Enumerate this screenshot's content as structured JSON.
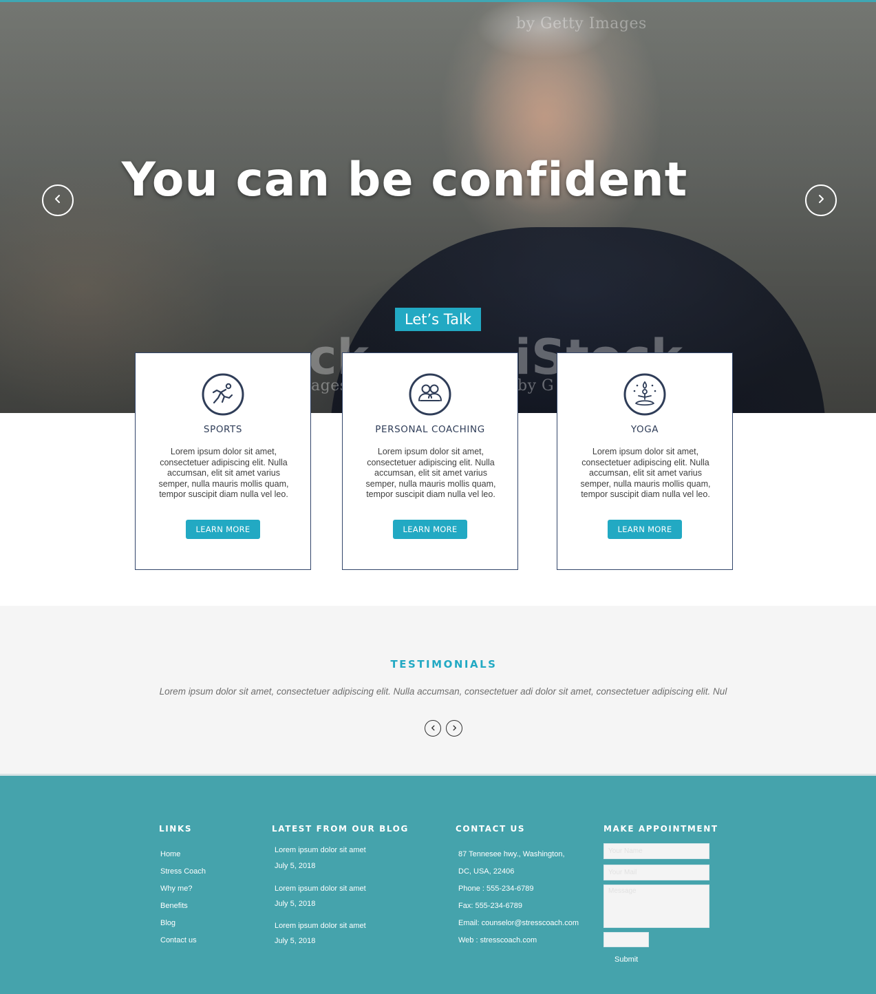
{
  "hero": {
    "title": "You can be confident",
    "cta_label": "Let’s Talk",
    "watermark_line": "by Getty Images",
    "watermark_big_left": "ck",
    "watermark_big_right": "iStock",
    "watermark_small_left": "ages",
    "watermark_small_right": "by G",
    "prev_icon": "chevron-left-icon",
    "next_icon": "chevron-right-icon"
  },
  "services": [
    {
      "title": "SPORTS",
      "icon": "runner-icon",
      "text": "Lorem ipsum dolor sit amet, consectetuer adipiscing elit. Nulla accumsan, elit sit amet varius semper, nulla mauris mollis quam, tempor suscipit diam nulla vel leo.",
      "button": "LEARN MORE"
    },
    {
      "title": "PERSONAL COACHING",
      "icon": "people-icon",
      "text": "Lorem ipsum dolor sit amet, consectetuer adipiscing elit. Nulla accumsan, elit sit amet varius semper, nulla mauris mollis quam, tempor suscipit diam nulla vel leo.",
      "button": "LEARN MORE"
    },
    {
      "title": "YOGA",
      "icon": "meditation-icon",
      "text": "Lorem ipsum dolor sit amet, consectetuer adipiscing elit. Nulla accumsan, elit sit amet varius semper, nulla mauris mollis quam, tempor suscipit diam nulla vel leo.",
      "button": "LEARN MORE"
    }
  ],
  "testimonials": {
    "title": "TESTIMONIALS",
    "text": "Lorem ipsum dolor sit amet, consectetuer adipiscing elit. Nulla accumsan, consectetuer adi dolor sit amet, consectetuer adipiscing elit. Nul"
  },
  "footer": {
    "links_heading": "LINKS",
    "links": [
      "Home",
      "Stress Coach",
      "Why me?",
      "Benefits",
      "Blog",
      "Contact us"
    ],
    "blog_heading": "LATEST FROM OUR BLOG",
    "blog_posts": [
      {
        "title": "Lorem ipsum dolor sit amet",
        "date": "July 5, 2018"
      },
      {
        "title": "Lorem ipsum dolor sit amet",
        "date": "July 5, 2018"
      },
      {
        "title": "Lorem ipsum dolor sit amet",
        "date": "July 5, 2018"
      }
    ],
    "contact_heading": "CONTACT US",
    "contact_lines": [
      "87 Tennesee hwy., Washington,",
      "DC, USA, 22406",
      "Phone : 555-234-6789",
      "Fax: 555-234-6789",
      "Email: counselor@stresscoach.com",
      "Web : stresscoach.com"
    ],
    "appointment_heading": "MAKE APPOINTMENT",
    "form": {
      "name_placeholder": "Your Name",
      "email_placeholder": "Your Mail",
      "message_placeholder": "Message",
      "submit_label": "Submit"
    }
  },
  "colors": {
    "accent": "#22a9c3",
    "footer_bg": "#45a3ac",
    "navy": "#2f3d58",
    "testimonials_bg": "#f5f5f5"
  }
}
